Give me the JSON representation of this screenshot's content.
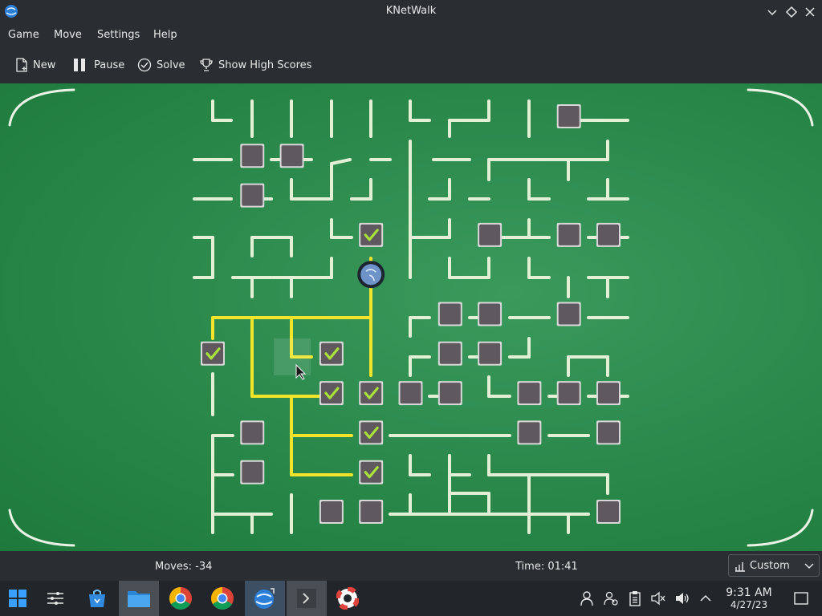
{
  "window": {
    "title": "KNetWalk",
    "controls": [
      {
        "icon": "minimize-icon"
      },
      {
        "icon": "maximize-icon"
      },
      {
        "icon": "close-icon"
      }
    ]
  },
  "menu": {
    "items": [
      "Game",
      "Move",
      "Settings",
      "Help"
    ]
  },
  "toolbar": {
    "new_label": "New",
    "pause_label": "Pause",
    "solve_label": "Solve",
    "highscores_label": "Show High Scores"
  },
  "board": {
    "background_color": "#2c8a4d",
    "wire_color": "#e4f0d6",
    "connected_wire_color": "#f1e42a",
    "terminal_color": "#5f585e",
    "connected_check_color": "#a8e23a",
    "server_icon": "globe-icon",
    "grid_columns": 11,
    "grid_rows": 11
  },
  "status": {
    "moves": "Moves: -34",
    "time": "Time: 01:41",
    "difficulty": "Custom"
  },
  "taskbar": {
    "apps": [
      {
        "icon": "start-menu-icon"
      },
      {
        "icon": "settings-sliders-icon"
      },
      {
        "icon": "store-icon"
      },
      {
        "icon": "file-manager-icon",
        "active": true
      },
      {
        "icon": "chrome-icon"
      },
      {
        "icon": "chrome-icon"
      },
      {
        "icon": "knetwalk-icon",
        "active": true
      },
      {
        "icon": "terminal-icon",
        "active": true
      },
      {
        "icon": "help-lifebuoy-icon"
      }
    ],
    "tray": [
      "user-icon",
      "users-icon",
      "clipboard-icon",
      "mute-icon",
      "volume-icon",
      "chevron-up-icon"
    ],
    "clock_time": "9:31 AM",
    "clock_date": "4/27/23"
  }
}
